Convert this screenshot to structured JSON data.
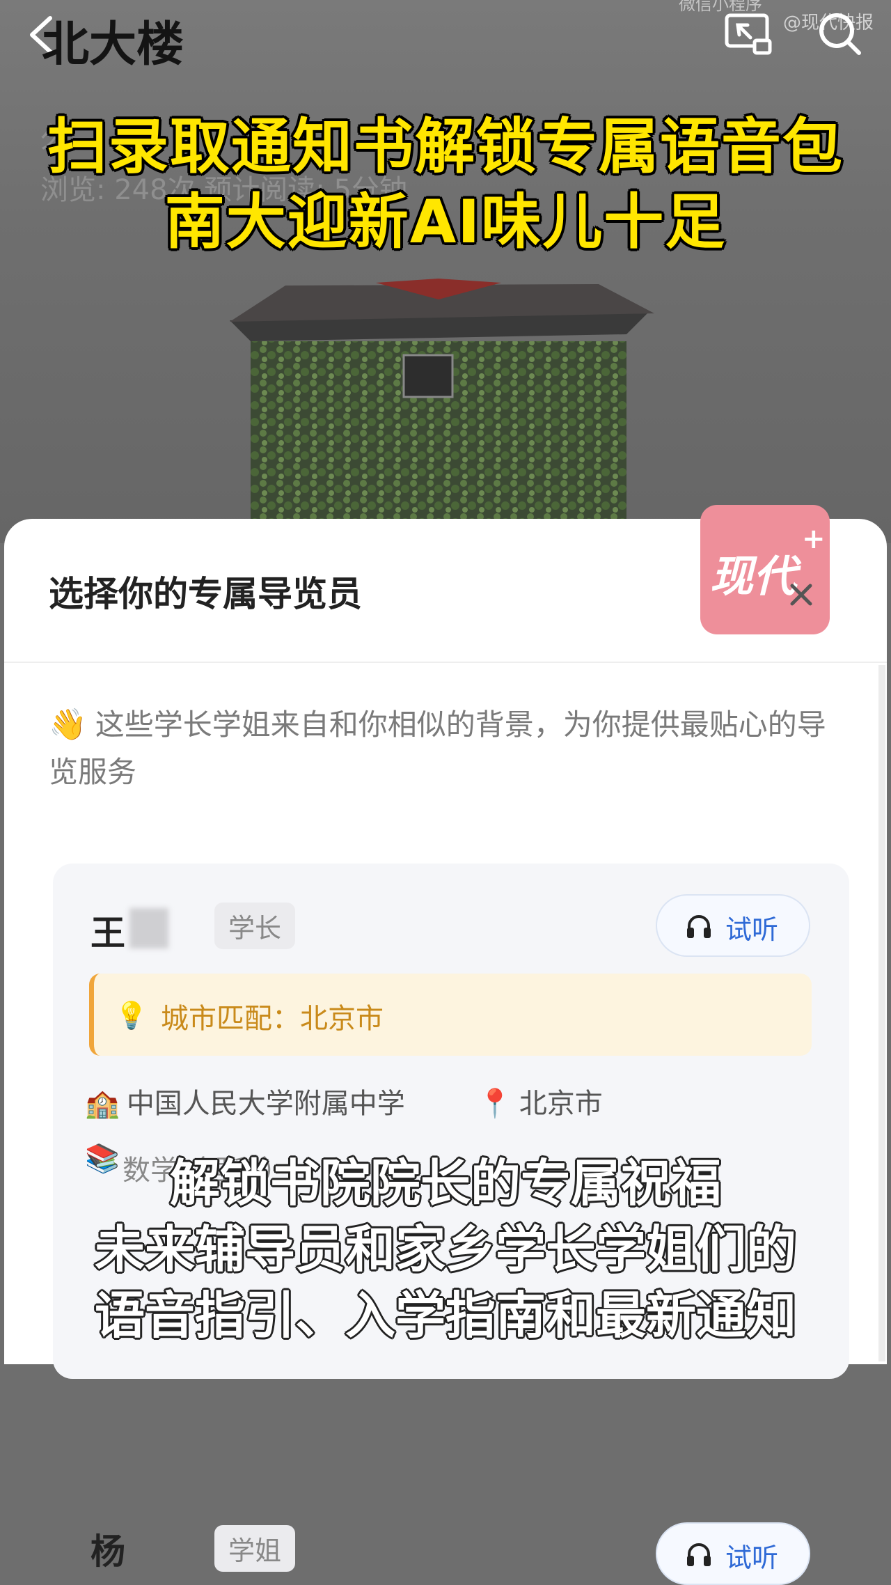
{
  "header": {
    "title": "北大楼",
    "watermark_top": "微信小程序",
    "watermark_handle": "@现代快报",
    "dim_prefix": "久",
    "dim_stats": "浏览: 248次   预计阅读: 5分钟"
  },
  "headline": {
    "line1": "扫录取通知书解锁专属语音包",
    "line2": "南大迎新AI味儿十足",
    "color": "#ffe600"
  },
  "sheet": {
    "title": "选择你的专属导览员",
    "intro_emoji": "👋",
    "intro": "这些学长学姐来自和你相似的背景，为你提供最贴心的导览服务",
    "logo_text": "现代",
    "logo_plus": "+",
    "logo_color": "#ee8f9a"
  },
  "guide_card": {
    "name": "王",
    "role": "学长",
    "listen_label": "试听",
    "match_label": "城市匹配：北京市",
    "school": "中国人民大学附属中学",
    "location": "北京市",
    "major_faint": "数学（理科）",
    "accent": "#2f6ad6",
    "match_color": "#f0a53a"
  },
  "guide_card_next": {
    "name": "杨",
    "role": "学姐",
    "listen_label": "试听"
  },
  "subtitles": {
    "line1": "解锁书院院长的专属祝福",
    "line2": "未来辅导员和家乡学长学姐们的",
    "line3": "语音指引、入学指南和最新通知"
  },
  "icons": [
    "back-icon",
    "share-icon",
    "search-icon",
    "close-icon",
    "headphone-icon",
    "bulb-icon",
    "school-icon",
    "pin-icon",
    "books-icon"
  ]
}
